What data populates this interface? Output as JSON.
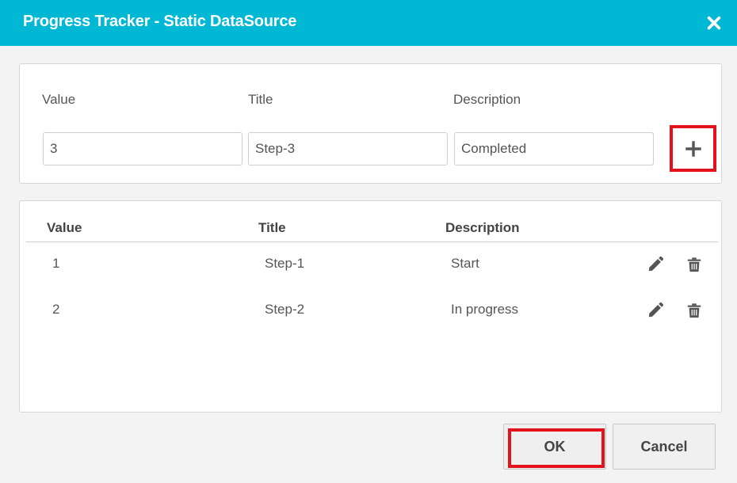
{
  "dialog": {
    "title": "Progress Tracker - Static DataSource"
  },
  "form": {
    "labels": {
      "value": "Value",
      "title": "Title",
      "description": "Description"
    },
    "inputs": {
      "value": "3",
      "title": "Step-3",
      "description": "Completed"
    }
  },
  "table": {
    "headers": {
      "value": "Value",
      "title": "Title",
      "description": "Description"
    },
    "rows": [
      {
        "value": "1",
        "title": "Step-1",
        "description": "Start"
      },
      {
        "value": "2",
        "title": "Step-2",
        "description": "In progress"
      }
    ]
  },
  "buttons": {
    "ok": "OK",
    "cancel": "Cancel"
  },
  "icons": {
    "close": "close-icon",
    "add": "plus-icon",
    "edit": "pencil-icon",
    "delete": "trash-icon"
  },
  "colors": {
    "header": "#00b8d4",
    "highlight": "#e3121b",
    "icon": "#555555"
  }
}
